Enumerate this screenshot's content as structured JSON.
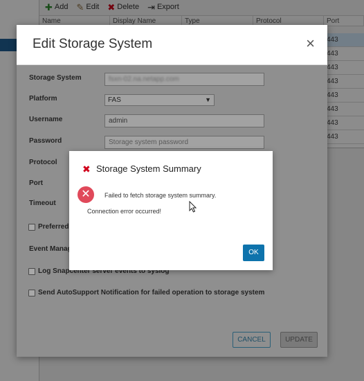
{
  "toolbar": {
    "add_label": "Add",
    "edit_label": "Edit",
    "delete_label": "Delete",
    "export_label": "Export"
  },
  "table": {
    "columns": [
      "Name",
      "Display Name",
      "Type",
      "Protocol",
      "Port"
    ],
    "ports": [
      "443",
      "443",
      "443",
      "443",
      "443",
      "443",
      "443",
      "443"
    ]
  },
  "edit_dialog": {
    "title": "Edit Storage System",
    "close_glyph": "×",
    "fields": {
      "storage_system_label": "Storage System",
      "storage_system_value": "fsxn-02.na.netapp.com",
      "platform_label": "Platform",
      "platform_value": "FAS",
      "username_label": "Username",
      "username_value": "admin",
      "password_label": "Password",
      "password_placeholder": "Storage system password",
      "protocol_label": "Protocol",
      "port_label": "Port",
      "timeout_label": "Timeout",
      "preferred_label": "Preferred",
      "event_label": "Event Manag"
    },
    "checkboxes": {
      "syslog_label": "Log Snapcenter server events to syslog",
      "autosupport_label": "Send AutoSupport Notification for failed operation to storage system"
    },
    "buttons": {
      "cancel_label": "CANCEL",
      "update_label": "UPDATE"
    }
  },
  "summary_dialog": {
    "title": "Storage System Summary",
    "message": "Failed to fetch storage system summary.",
    "detail": "Connection error occurred!",
    "ok_label": "OK",
    "error_color": "#d0021b"
  },
  "colors": {
    "primary_button": "#0e73ac",
    "overlay": "rgba(0,0,0,0.45)"
  }
}
